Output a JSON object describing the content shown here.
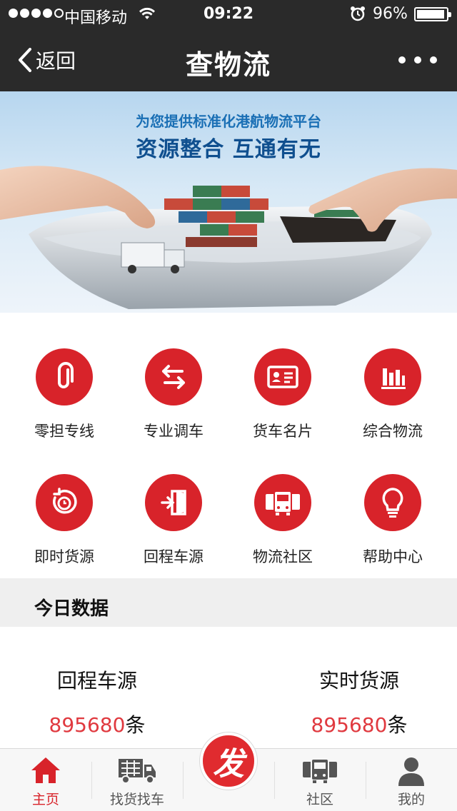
{
  "status_bar": {
    "carrier": "中国移动",
    "time": "09:22",
    "battery_percent_text": "96%",
    "battery_level": 0.96
  },
  "nav": {
    "back_label": "返回",
    "title": "查物流"
  },
  "banner": {
    "subtitle": "为您提供标准化港航物流平台",
    "headline": "资源整合 互通有无"
  },
  "menu": [
    {
      "label": "零担专线",
      "icon": "paperclip-icon"
    },
    {
      "label": "专业调车",
      "icon": "swap-arrows-icon"
    },
    {
      "label": "货车名片",
      "icon": "id-card-icon"
    },
    {
      "label": "综合物流",
      "icon": "bar-chart-icon"
    },
    {
      "label": "即时货源",
      "icon": "clock-refresh-icon"
    },
    {
      "label": "回程车源",
      "icon": "return-door-icon"
    },
    {
      "label": "物流社区",
      "icon": "trucks-icon"
    },
    {
      "label": "帮助中心",
      "icon": "lightbulb-icon"
    }
  ],
  "today": {
    "title": "今日数据",
    "stats": [
      {
        "name": "回程车源",
        "value": "895680",
        "unit": "条"
      },
      {
        "name": "实时货源",
        "value": "895680",
        "unit": "条"
      }
    ]
  },
  "tabs": [
    {
      "label": "主页",
      "icon": "home-icon",
      "active": true
    },
    {
      "label": "找货找车",
      "icon": "truck-icon",
      "active": false
    },
    {
      "label": "社区",
      "icon": "buses-icon",
      "active": false
    },
    {
      "label": "我的",
      "icon": "user-icon",
      "active": false
    }
  ],
  "publish_label": "发",
  "colors": {
    "accent": "#d8232a",
    "header_bg": "#2a2a2a",
    "stat_number": "#e0393f"
  }
}
